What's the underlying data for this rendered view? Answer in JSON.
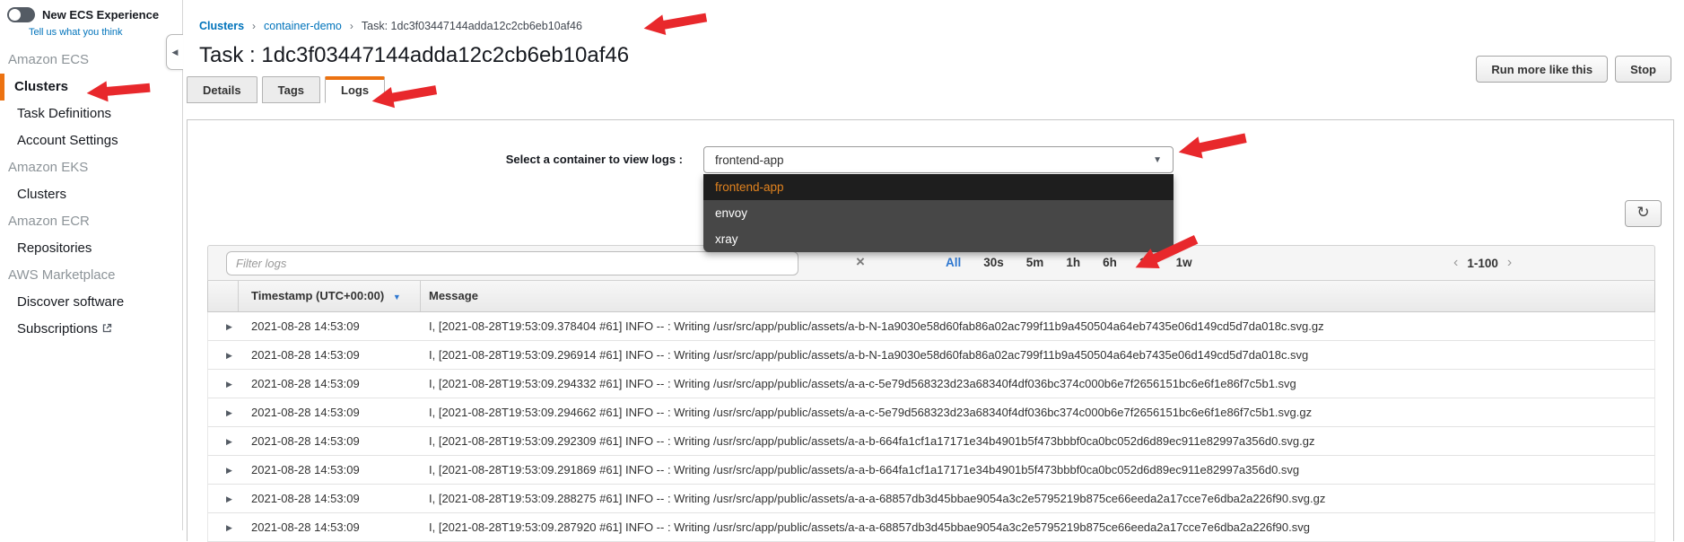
{
  "colors": {
    "accent_orange": "#ec7211",
    "link_blue": "#0073bb",
    "annotation_red": "#e8282c",
    "time_filter_blue": "#2e77d0",
    "dropdown_highlight_text": "#e0821e"
  },
  "sidebar": {
    "toggle_label": "New ECS Experience",
    "feedback_link": "Tell us what you think",
    "sections": [
      {
        "header": "Amazon ECS",
        "items": [
          {
            "label": "Clusters",
            "selected": true
          },
          {
            "label": "Task Definitions"
          },
          {
            "label": "Account Settings"
          }
        ]
      },
      {
        "header": "Amazon EKS",
        "items": [
          {
            "label": "Clusters"
          }
        ]
      },
      {
        "header": "Amazon ECR",
        "items": [
          {
            "label": "Repositories"
          }
        ]
      },
      {
        "header": "AWS Marketplace",
        "items": [
          {
            "label": "Discover software"
          },
          {
            "label": "Subscriptions",
            "external": true
          }
        ]
      }
    ]
  },
  "breadcrumb": {
    "items": [
      "Clusters",
      "container-demo",
      "Task: 1dc3f03447144adda12c2cb6eb10af46"
    ],
    "separator": "›"
  },
  "header": {
    "title": "Task : 1dc3f03447144adda12c2cb6eb10af46",
    "buttons": [
      {
        "label": "Run more like this"
      },
      {
        "label": "Stop"
      }
    ]
  },
  "tabs": [
    {
      "label": "Details"
    },
    {
      "label": "Tags"
    },
    {
      "label": "Logs",
      "active": true
    }
  ],
  "logs": {
    "select_label": "Select a container to view logs :",
    "selected_container": "frontend-app",
    "container_options": [
      "frontend-app",
      "envoy",
      "xray"
    ],
    "filter_placeholder": "Filter logs",
    "time_filters": [
      "All",
      "30s",
      "5m",
      "1h",
      "6h",
      "1d",
      "1w"
    ],
    "selected_time_filter": "All",
    "page_range": "1-100",
    "columns": {
      "timestamp": "Timestamp (UTC+00:00)",
      "message": "Message"
    },
    "rows": [
      {
        "timestamp": "2021-08-28 14:53:09",
        "message": "I, [2021-08-28T19:53:09.378404 #61] INFO -- : Writing /usr/src/app/public/assets/a-b-N-1a9030e58d60fab86a02ac799f11b9a450504a64eb7435e06d149cd5d7da018c.svg.gz"
      },
      {
        "timestamp": "2021-08-28 14:53:09",
        "message": "I, [2021-08-28T19:53:09.296914 #61] INFO -- : Writing /usr/src/app/public/assets/a-b-N-1a9030e58d60fab86a02ac799f11b9a450504a64eb7435e06d149cd5d7da018c.svg"
      },
      {
        "timestamp": "2021-08-28 14:53:09",
        "message": "I, [2021-08-28T19:53:09.294332 #61] INFO -- : Writing /usr/src/app/public/assets/a-a-c-5e79d568323d23a68340f4df036bc374c000b6e7f2656151bc6e6f1e86f7c5b1.svg"
      },
      {
        "timestamp": "2021-08-28 14:53:09",
        "message": "I, [2021-08-28T19:53:09.294662 #61] INFO -- : Writing /usr/src/app/public/assets/a-a-c-5e79d568323d23a68340f4df036bc374c000b6e7f2656151bc6e6f1e86f7c5b1.svg.gz"
      },
      {
        "timestamp": "2021-08-28 14:53:09",
        "message": "I, [2021-08-28T19:53:09.292309 #61] INFO -- : Writing /usr/src/app/public/assets/a-a-b-664fa1cf1a17171e34b4901b5f473bbbf0ca0bc052d6d89ec911e82997a356d0.svg.gz"
      },
      {
        "timestamp": "2021-08-28 14:53:09",
        "message": "I, [2021-08-28T19:53:09.291869 #61] INFO -- : Writing /usr/src/app/public/assets/a-a-b-664fa1cf1a17171e34b4901b5f473bbbf0ca0bc052d6d89ec911e82997a356d0.svg"
      },
      {
        "timestamp": "2021-08-28 14:53:09",
        "message": "I, [2021-08-28T19:53:09.288275 #61] INFO -- : Writing /usr/src/app/public/assets/a-a-a-68857db3d45bbae9054a3c2e5795219b875ce66eeda2a17cce7e6dba2a226f90.svg.gz"
      },
      {
        "timestamp": "2021-08-28 14:53:09",
        "message": "I, [2021-08-28T19:53:09.287920 #61] INFO -- : Writing /usr/src/app/public/assets/a-a-a-68857db3d45bbae9054a3c2e5795219b875ce66eeda2a17cce7e6dba2a226f90.svg"
      }
    ]
  },
  "icons": {
    "collapse": "◀",
    "select_chevron": "▼",
    "sort_desc": "▼",
    "expander": "▶",
    "clear_filter": "×",
    "refresh": "↻",
    "page_prev": "‹",
    "page_next": "›",
    "crumb_sep": "›"
  },
  "annotations": {
    "color": "#e8282c",
    "arrows": [
      "points-to-sidebar-clusters",
      "points-to-breadcrumb-task-id",
      "points-to-logs-tab",
      "points-to-container-dropdown",
      "points-to-log-messages"
    ]
  }
}
